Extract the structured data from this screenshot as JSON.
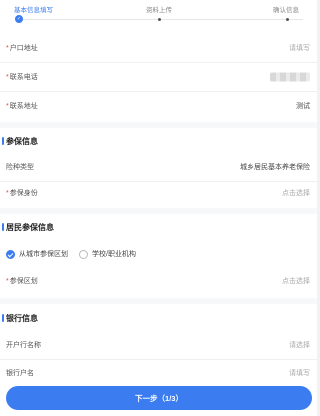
{
  "stepper": {
    "steps": [
      {
        "label": "基本信息填写",
        "active": true
      },
      {
        "label": "资料上传",
        "active": false
      },
      {
        "label": "确认信息",
        "active": false
      }
    ],
    "check_glyph": "✓"
  },
  "basic": {
    "household": {
      "label": "户口地址",
      "placeholder": "请填写",
      "required": true
    },
    "phone": {
      "label": "联系电话",
      "required": true
    },
    "contact_address": {
      "label": "联系地址",
      "value": "测试",
      "required": true
    }
  },
  "insurance": {
    "title": "参保信息",
    "type": {
      "label": "险种类型",
      "value": "城乡居民基本养老保险"
    },
    "identity": {
      "label": "参保身份",
      "placeholder": "点击选择",
      "required": true
    }
  },
  "resident": {
    "title": "居民参保信息",
    "radios": [
      {
        "label": "从城市参保区划",
        "checked": true
      },
      {
        "label": "学校/职业机构",
        "checked": false
      }
    ],
    "region": {
      "label": "参保区划",
      "placeholder": "点击选择",
      "required": true
    }
  },
  "bank": {
    "title": "银行信息",
    "bank_name": {
      "label": "开户行名称",
      "placeholder": "请选择"
    },
    "account_name": {
      "label": "银行户名",
      "placeholder": "请填写"
    }
  },
  "next_button": "下一步（1/3）",
  "required_mark": "*",
  "colors": {
    "accent": "#3b7cf0",
    "required": "#e64340"
  }
}
